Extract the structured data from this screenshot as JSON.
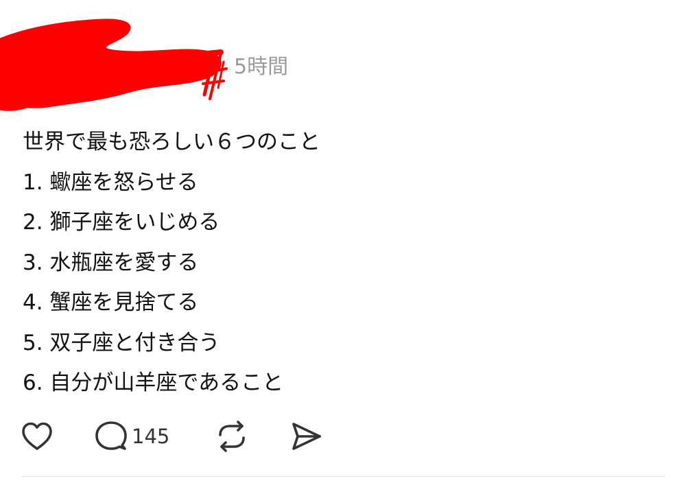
{
  "post": {
    "timestamp": "5時間",
    "lines": [
      "世界で最も恐ろしい６つのこと",
      "1. 蠍座を怒らせる",
      "2. 獅子座をいじめる",
      "3. 水瓶座を愛する",
      "4. 蟹座を見捨てる",
      "5. 双子座と付き合う",
      "6. 自分が山羊座であること"
    ]
  },
  "actions": {
    "like_icon": "heart-icon",
    "reply_icon": "speech-bubble-icon",
    "reply_count": "145",
    "repost_icon": "repost-arrows-icon",
    "share_icon": "send-icon"
  },
  "colors": {
    "redaction": "#ff0000",
    "timestamp": "#9a9a9a",
    "text": "#111111",
    "icon": "#333333",
    "divider": "#e2e2e2"
  }
}
